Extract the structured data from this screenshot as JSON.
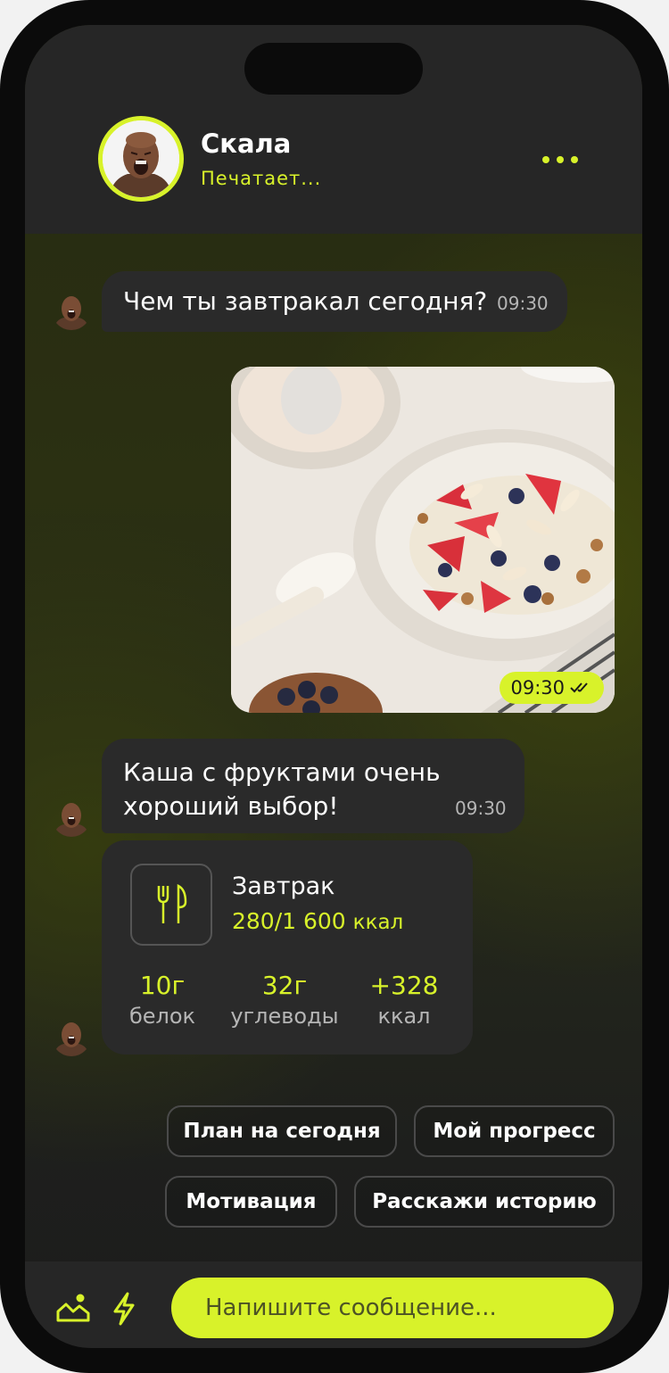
{
  "header": {
    "name": "Скала",
    "status": "Печатает...",
    "more_icon": "more-dots-icon"
  },
  "messages": [
    {
      "text": "Чем ты завтракал сегодня?",
      "time": "09:30",
      "from": "coach"
    },
    {
      "type": "image",
      "image": "bowl of porridge with strawberries, blueberries, almonds and granola",
      "time": "09:30",
      "read_icon": "double-check-icon",
      "from": "me"
    },
    {
      "line1": "Каша с фруктами очень",
      "line2": "хороший выбор!",
      "time": "09:30",
      "from": "coach"
    }
  ],
  "meal_card": {
    "icon": "fork-knife-icon",
    "title": "Завтрак",
    "kcal_value": "280/1 600",
    "kcal_unit": "ккал",
    "stats": [
      {
        "value": "10г",
        "label": "белок"
      },
      {
        "value": "32г",
        "label": "углеводы"
      },
      {
        "value": "+328",
        "label": "ккал"
      }
    ]
  },
  "quick_replies": [
    "План на сегодня",
    "Мой прогресс",
    "Мотивация",
    "Расскажи историю"
  ],
  "composer": {
    "placeholder": "Напишите сообщение...",
    "gallery_icon": "gallery-icon",
    "bolt_icon": "lightning-icon"
  },
  "colors": {
    "accent": "#d8f22a",
    "bubble": "#2a2a2a",
    "header": "#262626"
  }
}
